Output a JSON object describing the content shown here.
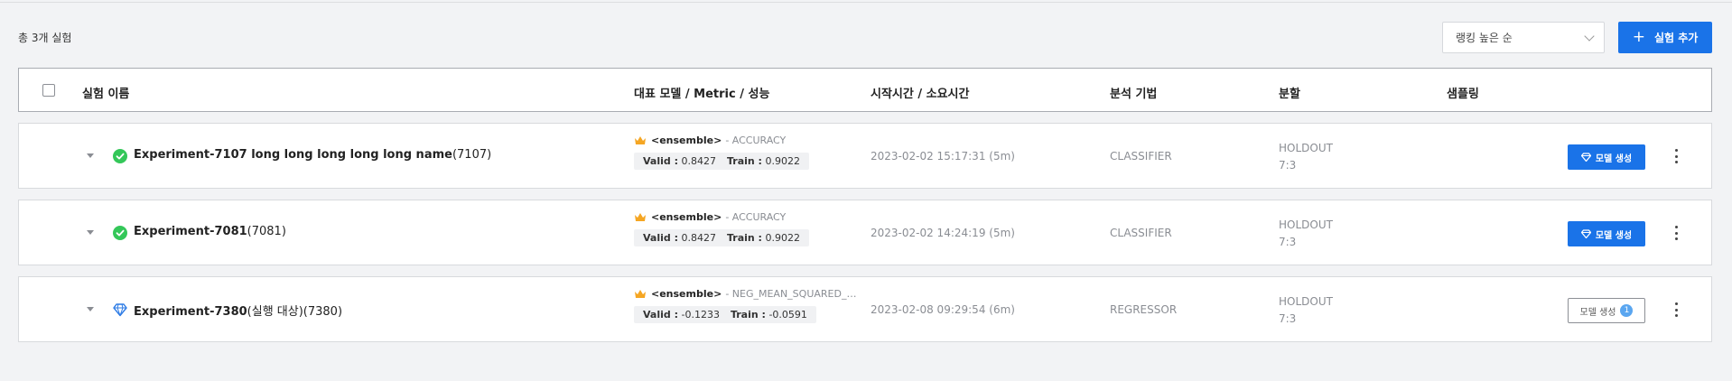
{
  "summary": {
    "total_label": "총 3개 실험"
  },
  "toolbar": {
    "sort_selected": "랭킹 높은 순",
    "add_label": "실험 추가"
  },
  "table": {
    "columns": [
      "실험 이름",
      "대표 모델 / Metric / 성능",
      "시작시간 / 소요시간",
      "분석 기법",
      "분할",
      "샘플링"
    ],
    "rows": [
      {
        "status": "check-circle-icon",
        "name": "Experiment-7107 long long long long long name",
        "name_suffix": "",
        "id": "(7107)",
        "model": "<ensemble>",
        "metric": "- ACCURACY",
        "valid_label": "Valid :",
        "valid": "0.8427",
        "train_label": "Train :",
        "train": "0.9022",
        "start": "2023-02-02 15:17:31 (5m)",
        "method": "CLASSIFIER",
        "split_type": "HOLDOUT",
        "split_ratio": "7:3",
        "sampling": "",
        "action_label": "모델 생성",
        "action_badge": ""
      },
      {
        "status": "check-circle-icon",
        "name": "Experiment-7081",
        "name_suffix": "",
        "id": "(7081)",
        "model": "<ensemble>",
        "metric": "- ACCURACY",
        "valid_label": "Valid :",
        "valid": "0.8427",
        "train_label": "Train :",
        "train": "0.9022",
        "start": "2023-02-02 14:24:19 (5m)",
        "method": "CLASSIFIER",
        "split_type": "HOLDOUT",
        "split_ratio": "7:3",
        "sampling": "",
        "action_label": "모델 생성",
        "action_badge": ""
      },
      {
        "status": "diamond-icon",
        "name": "Experiment-7380",
        "name_suffix": "(실행 대상)",
        "id": "(7380)",
        "model": "<ensemble>",
        "metric": "- NEG_MEAN_SQUARED_ERR...",
        "valid_label": "Valid :",
        "valid": "-0.1233",
        "train_label": "Train :",
        "train": "-0.0591",
        "start": "2023-02-08 09:29:54 (6m)",
        "method": "REGRESSOR",
        "split_type": "HOLDOUT",
        "split_ratio": "7:3",
        "sampling": "",
        "action_label": "모델 생성",
        "action_badge": "1"
      }
    ]
  },
  "colors": {
    "accent": "#1a73e8",
    "success": "#34c759",
    "background": "#f2f3f5"
  }
}
